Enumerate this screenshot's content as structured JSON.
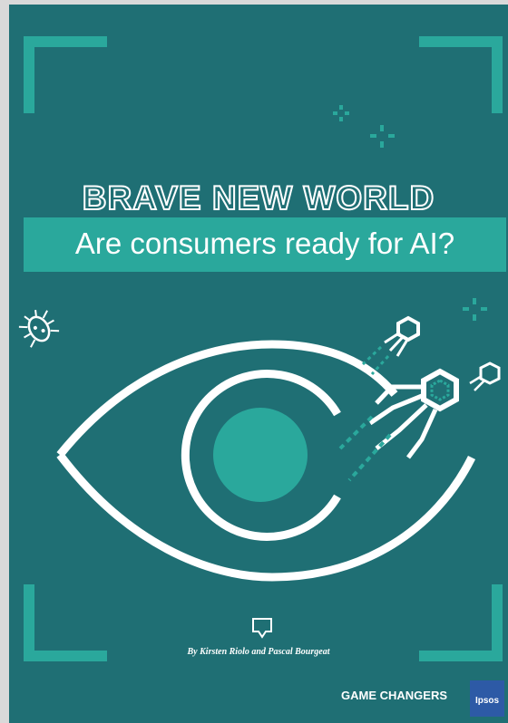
{
  "cover": {
    "title": "BRAVE NEW WORLD",
    "subtitle": "Are consumers ready for AI?",
    "byline": "By Kirsten Riolo and Pascal Bourgeat",
    "brand": "GAME CHANGERS",
    "logo_text": "Ipsos"
  },
  "colors": {
    "background": "#1f6f74",
    "accent": "#2aa89c",
    "white": "#ffffff",
    "logo": "#2d5aa6"
  },
  "icons": [
    "corner-bracket-icon",
    "sparkle-icon",
    "circuit-bug-icon",
    "eye-icon",
    "nanobot-icon",
    "speech-bubble-icon"
  ]
}
